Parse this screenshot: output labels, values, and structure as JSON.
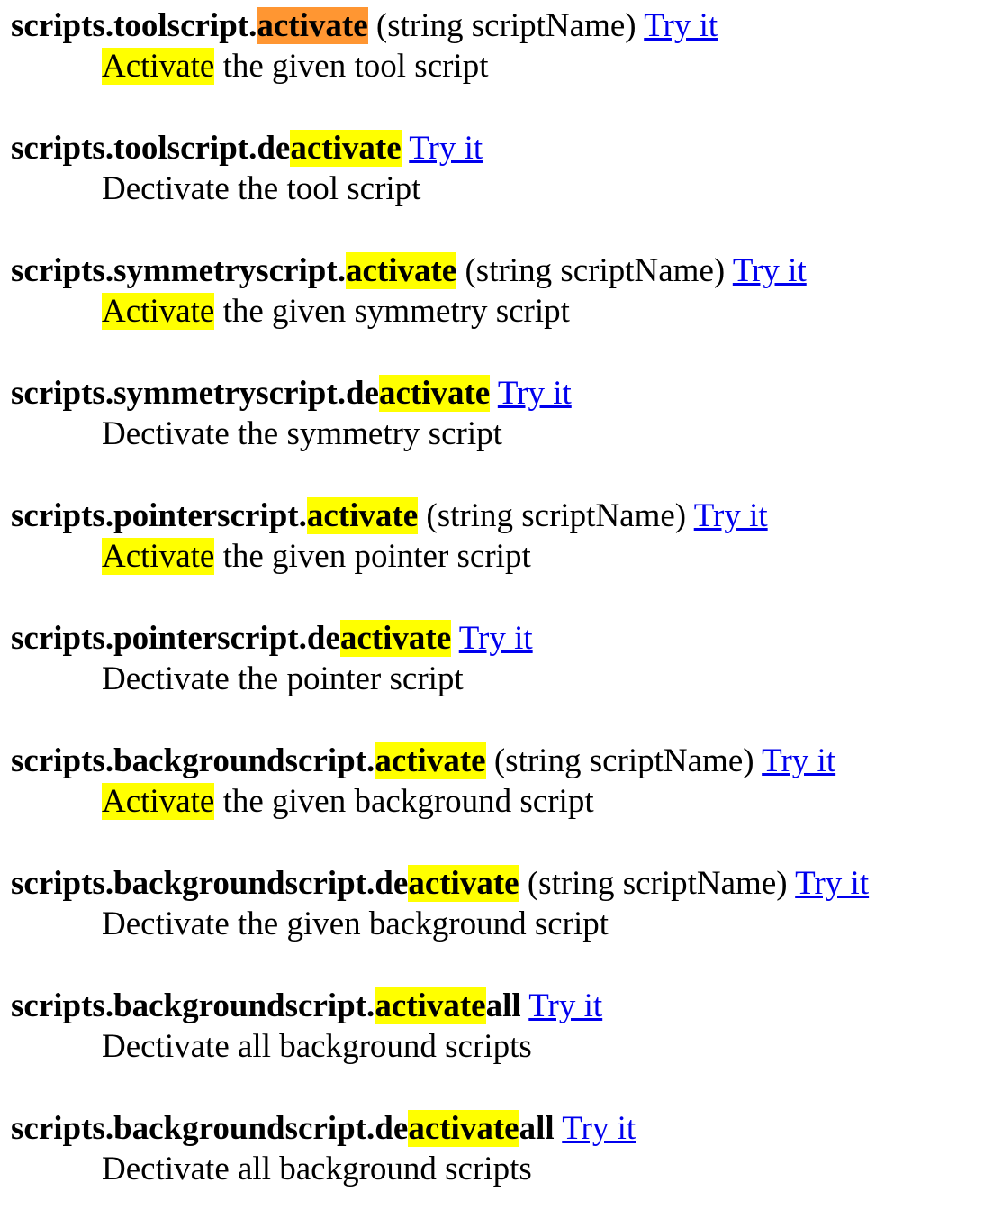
{
  "colors": {
    "highlight": "#ffff00",
    "current_match": "#ff9632",
    "link": "#0000ee",
    "text": "#000000",
    "background": "#ffffff"
  },
  "entries": [
    {
      "prefix": "scripts.toolscript.",
      "match": "activate",
      "suffix": "",
      "current": true,
      "signature": "(string scriptName)",
      "link": "Try it",
      "desc_match": "Activate",
      "desc_rest": " the given tool script"
    },
    {
      "prefix": "scripts.toolscript.de",
      "match": "activate",
      "suffix": "",
      "current": false,
      "signature": "",
      "link": "Try it",
      "desc_match": "",
      "desc_rest": "Dectivate the tool script"
    },
    {
      "prefix": "scripts.symmetryscript.",
      "match": "activate",
      "suffix": "",
      "current": false,
      "signature": "(string scriptName)",
      "link": "Try it",
      "desc_match": "Activate",
      "desc_rest": " the given symmetry script"
    },
    {
      "prefix": "scripts.symmetryscript.de",
      "match": "activate",
      "suffix": "",
      "current": false,
      "signature": "",
      "link": "Try it",
      "desc_match": "",
      "desc_rest": "Dectivate the symmetry script"
    },
    {
      "prefix": "scripts.pointerscript.",
      "match": "activate",
      "suffix": "",
      "current": false,
      "signature": "(string scriptName)",
      "link": "Try it",
      "desc_match": "Activate",
      "desc_rest": " the given pointer script"
    },
    {
      "prefix": "scripts.pointerscript.de",
      "match": "activate",
      "suffix": "",
      "current": false,
      "signature": "",
      "link": "Try it",
      "desc_match": "",
      "desc_rest": "Dectivate the pointer script"
    },
    {
      "prefix": "scripts.backgroundscript.",
      "match": "activate",
      "suffix": "",
      "current": false,
      "signature": "(string scriptName)",
      "link": "Try it",
      "desc_match": "Activate",
      "desc_rest": " the given background script"
    },
    {
      "prefix": "scripts.backgroundscript.de",
      "match": "activate",
      "suffix": "",
      "current": false,
      "signature": "(string scriptName)",
      "link": "Try it",
      "desc_match": "",
      "desc_rest": "Dectivate the given background script"
    },
    {
      "prefix": "scripts.backgroundscript.",
      "match": "activate",
      "suffix": "all",
      "current": false,
      "signature": "",
      "link": "Try it",
      "desc_match": "",
      "desc_rest": "Dectivate all background scripts"
    },
    {
      "prefix": "scripts.backgroundscript.de",
      "match": "activate",
      "suffix": "all",
      "current": false,
      "signature": "",
      "link": "Try it",
      "desc_match": "",
      "desc_rest": "Dectivate all background scripts"
    }
  ]
}
